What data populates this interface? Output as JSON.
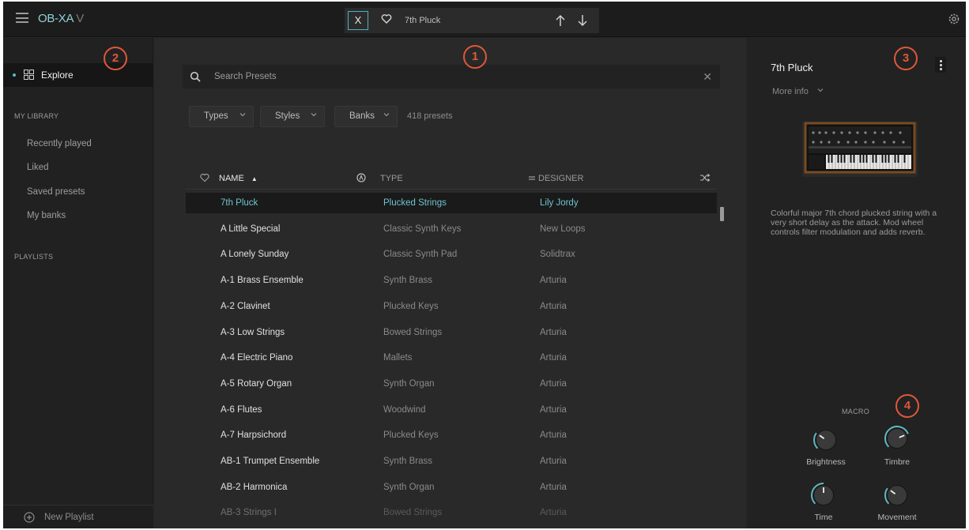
{
  "app": {
    "title": "OB-XA",
    "title_suffix": "V",
    "current_preset": "7th Pluck",
    "close_label": "X"
  },
  "sidebar": {
    "explore_label": "Explore",
    "library_heading": "MY LIBRARY",
    "library_items": [
      "Recently played",
      "Liked",
      "Saved presets",
      "My banks"
    ],
    "playlists_heading": "PLAYLISTS",
    "new_playlist_label": "New Playlist"
  },
  "browser": {
    "search_placeholder": "Search Presets",
    "filters": [
      "Types",
      "Styles",
      "Banks"
    ],
    "preset_count": "418 presets",
    "columns": {
      "name": "NAME",
      "type": "TYPE",
      "designer": "DESIGNER"
    },
    "rows": [
      {
        "name": "7th Pluck",
        "type": "Plucked Strings",
        "designer": "Lily Jordy"
      },
      {
        "name": "A Little Special",
        "type": "Classic Synth Keys",
        "designer": "New Loops"
      },
      {
        "name": "A Lonely Sunday",
        "type": "Classic Synth Pad",
        "designer": "Solidtrax"
      },
      {
        "name": "A-1 Brass Ensemble",
        "type": "Synth Brass",
        "designer": "Arturia"
      },
      {
        "name": "A-2 Clavinet",
        "type": "Plucked Keys",
        "designer": "Arturia"
      },
      {
        "name": "A-3 Low Strings",
        "type": "Bowed Strings",
        "designer": "Arturia"
      },
      {
        "name": "A-4 Electric Piano",
        "type": "Mallets",
        "designer": "Arturia"
      },
      {
        "name": "A-5 Rotary Organ",
        "type": "Synth Organ",
        "designer": "Arturia"
      },
      {
        "name": "A-6 Flutes",
        "type": "Woodwind",
        "designer": "Arturia"
      },
      {
        "name": "A-7 Harpsichord",
        "type": "Plucked Keys",
        "designer": "Arturia"
      },
      {
        "name": "AB-1 Trumpet Ensemble",
        "type": "Synth Brass",
        "designer": "Arturia"
      },
      {
        "name": "AB-2 Harmonica",
        "type": "Synth Organ",
        "designer": "Arturia"
      },
      {
        "name": "AB-3 Strings I",
        "type": "Bowed Strings",
        "designer": "Arturia"
      }
    ]
  },
  "details": {
    "title": "7th Pluck",
    "more_info": "More info",
    "description": "Colorful major 7th chord plucked string with a very short delay as the attack. Mod wheel controls filter modulation and adds reverb.",
    "macro_label": "MACRO",
    "macros": [
      {
        "name": "Brightness",
        "value": 0.3
      },
      {
        "name": "Timbre",
        "value": 0.75
      },
      {
        "name": "Time",
        "value": 0.5
      },
      {
        "name": "Movement",
        "value": 0.3
      }
    ]
  },
  "annotations": [
    "1",
    "2",
    "3",
    "4"
  ],
  "colors": {
    "accent": "#5cb8c3",
    "annotation": "#e0573a"
  }
}
